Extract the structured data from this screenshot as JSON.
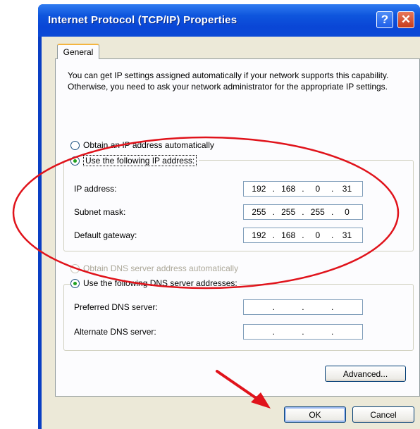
{
  "window": {
    "title": "Internet Protocol (TCP/IP) Properties",
    "help_glyph": "?",
    "close_glyph": "✕"
  },
  "tabs": [
    {
      "label": "General",
      "active": true
    }
  ],
  "intro_text": "You can get IP settings assigned automatically if your network supports this capability. Otherwise, you need to ask your network administrator for the appropriate IP settings.",
  "ip_section": {
    "auto_option": {
      "label": "Obtain an IP address automatically",
      "checked": false
    },
    "manual_option": {
      "label": "Use the following IP address:",
      "checked": true
    },
    "fields": [
      {
        "label": "IP address:",
        "octets": [
          "192",
          "168",
          "0",
          "31"
        ]
      },
      {
        "label": "Subnet mask:",
        "octets": [
          "255",
          "255",
          "255",
          "0"
        ]
      },
      {
        "label": "Default gateway:",
        "octets": [
          "192",
          "168",
          "0",
          "31"
        ]
      }
    ]
  },
  "dns_section": {
    "auto_option": {
      "label": "Obtain DNS server address automatically",
      "checked": false,
      "disabled": true
    },
    "manual_option": {
      "label": "Use the following DNS server addresses:",
      "checked": true
    },
    "fields": [
      {
        "label": "Preferred DNS server:",
        "octets": [
          "",
          "",
          "",
          ""
        ]
      },
      {
        "label": "Alternate DNS server:",
        "octets": [
          "",
          "",
          "",
          ""
        ]
      }
    ]
  },
  "buttons": {
    "advanced": "Advanced...",
    "ok": "OK",
    "cancel": "Cancel"
  },
  "colors": {
    "title_bar": "#0a46d6",
    "dialog_face": "#ece9d8",
    "annotation": "#e0131b"
  }
}
